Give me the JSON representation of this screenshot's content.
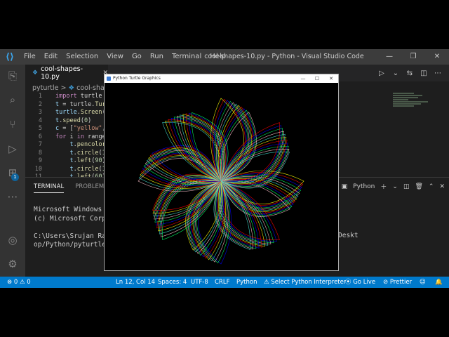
{
  "titlebar": {
    "menu": [
      "File",
      "Edit",
      "Selection",
      "View",
      "Go",
      "Run",
      "Terminal",
      "Help"
    ],
    "title": "cool-shapes-10.py - Python - Visual Studio Code"
  },
  "tab": {
    "name": "cool-shapes-10.py"
  },
  "breadcrumb": {
    "folder": "pyturtle",
    "sep": ">",
    "file": "cool-shape"
  },
  "code": {
    "line_numbers": [
      "1",
      "2",
      "3",
      "4",
      "5",
      "6",
      "7",
      "8",
      "9",
      "10",
      "11"
    ],
    "lines": [
      "import turtle",
      "t = turtle.Turt",
      "turtle.Screen(",
      "t.speed(0)",
      "c = [\"yellow\",",
      "for i in range",
      "    t.pencolor",
      "    t.circle(15",
      "    t.left(90)",
      "    t.circle(15",
      "    t.left(60)"
    ]
  },
  "panel": {
    "tabs": [
      "TERMINAL",
      "PROBLEMS"
    ],
    "shell": "Python"
  },
  "terminal": {
    "lines": [
      "Microsoft Windows [",
      "(c) Microsoft Corpo",
      "",
      "C:\\Users\\Srujan Ra",
      "op/Python/pyturtle/"
    ],
    "right_fragment": "Deskt"
  },
  "turtle_window": {
    "title": "Python Turtle Graphics",
    "colors": [
      "#ffff00",
      "#ff0000",
      "#0000ff",
      "#00ff66",
      "#ffc0cb",
      "#40e0d0"
    ]
  },
  "statusbar": {
    "errors": "0",
    "warnings": "0",
    "position": "Ln 12, Col 14",
    "spaces": "Spaces: 4",
    "encoding": "UTF-8",
    "eol": "CRLF",
    "language": "Python",
    "interpreter": "Select Python Interpreter",
    "golive": "Go Live",
    "prettier": "Prettier"
  },
  "colors": {
    "accent": "#007acc",
    "titlebar": "#3c3c3c",
    "editor": "#1e1e1e"
  }
}
